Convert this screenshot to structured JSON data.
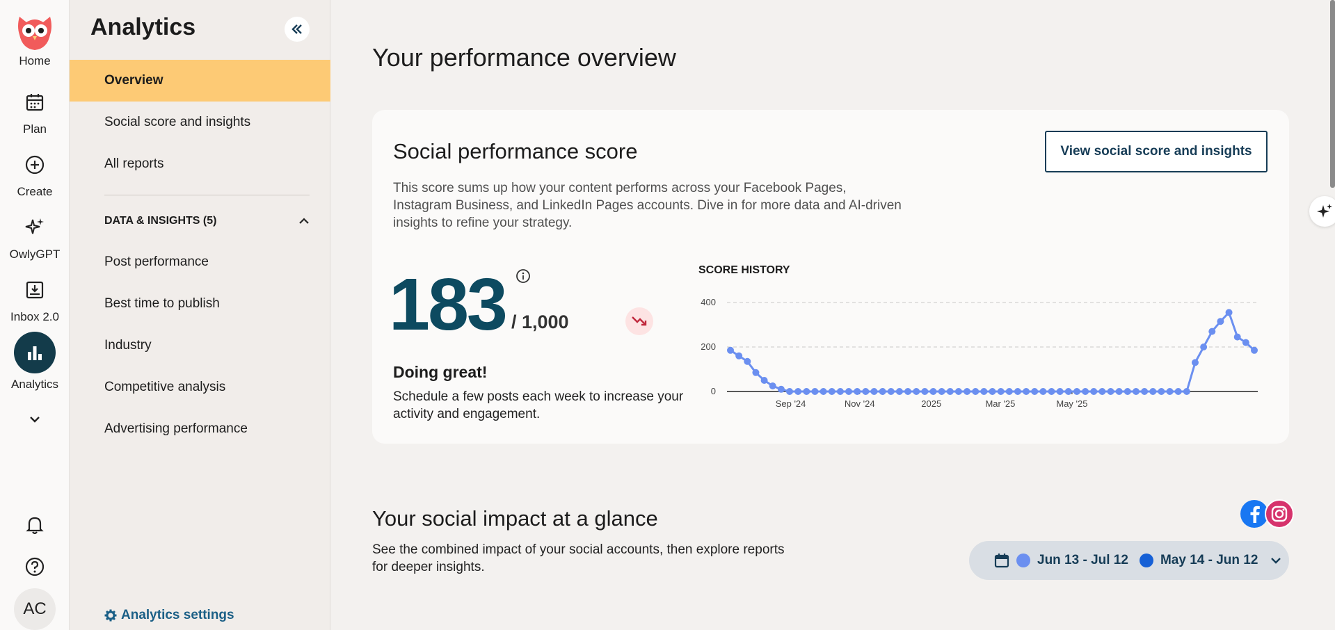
{
  "rail": {
    "items": [
      {
        "label": "Home",
        "icon": "owl-logo-icon"
      },
      {
        "label": "Plan",
        "icon": "calendar-icon"
      },
      {
        "label": "Create",
        "icon": "plus-circle-icon"
      },
      {
        "label": "OwlyGPT",
        "icon": "sparkle-icon"
      },
      {
        "label": "Inbox 2.0",
        "icon": "inbox-icon"
      },
      {
        "label": "Analytics",
        "icon": "bar-chart-icon"
      }
    ],
    "avatar": "AC"
  },
  "sidebar": {
    "title": "Analytics",
    "items": [
      {
        "label": "Overview",
        "active": true
      },
      {
        "label": "Social score and insights"
      },
      {
        "label": "All reports"
      }
    ],
    "section_label": "DATA & INSIGHTS (5)",
    "section_items": [
      {
        "label": "Post performance"
      },
      {
        "label": "Best time to publish"
      },
      {
        "label": "Industry"
      },
      {
        "label": "Competitive analysis"
      },
      {
        "label": "Advertising performance"
      }
    ],
    "settings_label": "Analytics settings"
  },
  "main": {
    "page_title": "Your performance overview",
    "score_card": {
      "title": "Social performance score",
      "button_label": "View social score and insights",
      "description": "This score sums up how your content performs across your Facebook Pages, Instagram Business, and LinkedIn Pages accounts. Dive in for more data and AI-driven insights to refine your strategy.",
      "score": "183",
      "score_max": "/ 1,000",
      "status_title": "Doing great!",
      "status_desc": "Schedule a few posts each week to increase your activity and engagement.",
      "chart_title": "SCORE HISTORY"
    },
    "impact": {
      "title": "Your social impact at a glance",
      "description": "See the combined impact of your social accounts, then explore reports for deeper insights.",
      "range_current": "Jun 13 - Jul 12",
      "range_previous": "May 14 - Jun 12"
    }
  },
  "colors": {
    "accent_active": "#fdca75",
    "score_color": "#0d4a60",
    "line_color": "#6b8ff0",
    "range_current_dot": "#6b8ff0",
    "range_previous_dot": "#1660d6"
  },
  "chart_data": {
    "type": "line",
    "title": "SCORE HISTORY",
    "xlabel": "",
    "ylabel": "",
    "ylim": [
      0,
      400
    ],
    "yticks": [
      0,
      200,
      400
    ],
    "xticks": [
      "Sep '24",
      "Nov '24",
      "2025",
      "Mar '25",
      "May '25"
    ],
    "grid": true,
    "series": [
      {
        "values": [
          185,
          160,
          135,
          85,
          50,
          25,
          10,
          0,
          0,
          0,
          0,
          0,
          0,
          0,
          0,
          0,
          0,
          0,
          0,
          0,
          0,
          0,
          0,
          0,
          0,
          0,
          0,
          0,
          0,
          0,
          0,
          0,
          0,
          0,
          0,
          0,
          0,
          0,
          0,
          0,
          0,
          0,
          0,
          0,
          0,
          0,
          0,
          0,
          0,
          0,
          0,
          0,
          0,
          0,
          0,
          130,
          200,
          270,
          315,
          355,
          245,
          220,
          185
        ]
      }
    ]
  }
}
